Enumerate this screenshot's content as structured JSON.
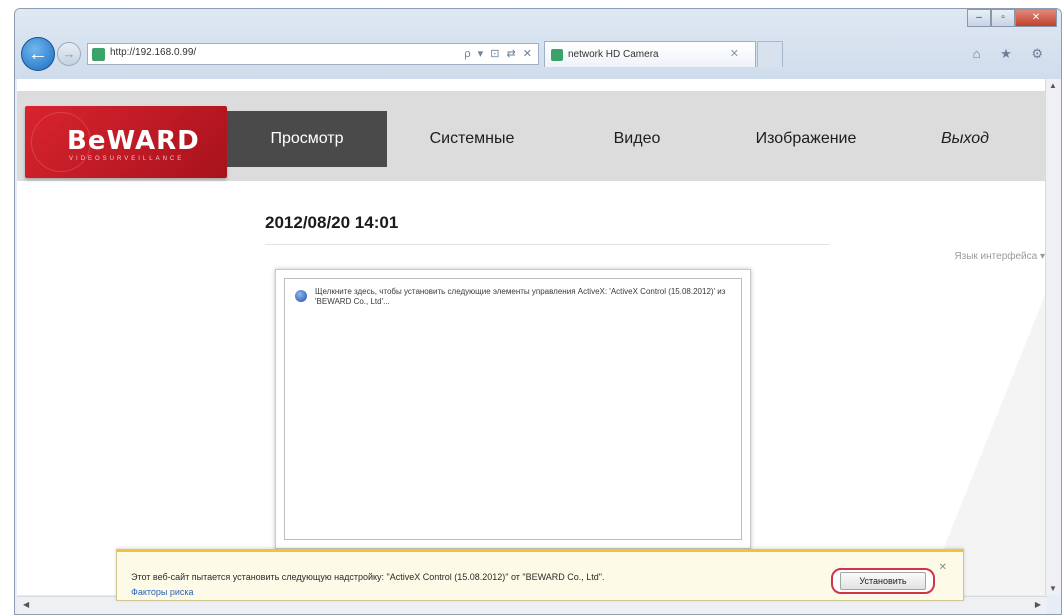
{
  "browser": {
    "address_url": "http://192.168.0.99/",
    "address_tools": "ρ ▾ ⊡ ⇄ ✕",
    "tab_title": "network HD Camera",
    "tab_close": "✕",
    "back_glyph": "←",
    "forward_glyph": "→",
    "window_controls": [
      "–",
      "▫",
      "✕"
    ],
    "toolbar_icons": "⌂ ★ ⚙"
  },
  "header": {
    "logo_text": "BeWARD",
    "logo_sub": "VIDEOSURVEILLANCE",
    "menu": [
      {
        "label": "Просмотр",
        "active": true
      },
      {
        "label": "Системные",
        "active": false
      },
      {
        "label": "Видео",
        "active": false
      },
      {
        "label": "Изображение",
        "active": false
      },
      {
        "label": "Выход",
        "active": false
      }
    ]
  },
  "main": {
    "datetime": "2012/08/20 14:01",
    "language_selector": "Язык интерфейса ▾",
    "activex_notice": "Щелкните здесь, чтобы установить следующие элементы управления ActiveX: 'ActiveX Control (15.08.2012)' из 'BEWARD Co., Ltd'..."
  },
  "infobar": {
    "message": "Этот веб-сайт пытается установить следующую надстройку: \"ActiveX Control (15.08.2012)\" от \"BEWARD Co., Ltd\".",
    "risk_link": "Факторы риска",
    "install_button": "Установить",
    "close_glyph": "✕"
  },
  "icons": {
    "back": "back-arrow-icon",
    "forward": "forward-arrow-icon",
    "favicon": "page-favicon-icon",
    "activex": "shield-icon",
    "home": "home-icon",
    "favorites": "star-icon",
    "tools": "gear-icon"
  },
  "colors": {
    "brand_red": "#c41c26",
    "menu_active_bg": "#4a4a4a",
    "infobar_accent": "#f3c23d",
    "install_highlight": "#d0344a"
  }
}
